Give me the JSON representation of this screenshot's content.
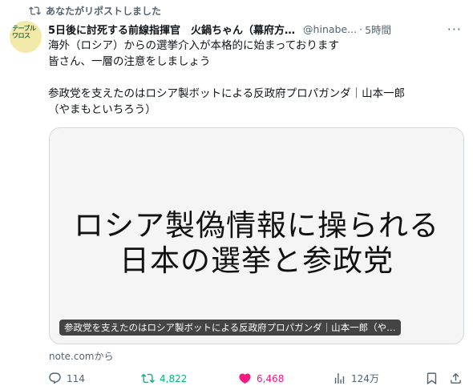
{
  "repost": {
    "label": "あなたがリポストしました"
  },
  "author": {
    "avatar_label": "テーブルワロス",
    "display_name": "5日後に討死する前線指揮官　火鍋ちゃん（幕府方…",
    "handle": "@hinabe...",
    "time": "5時間"
  },
  "tweet": {
    "line1": "海外（ロシア）からの選挙介入が本格的に始まっております",
    "line2": "皆さん、一層の注意をしましょう",
    "line3": "参政党を支えたのはロシア製ボットによる反政府プロパガンダ｜山本一郎",
    "line4": "（やまもといちろう）"
  },
  "card": {
    "headline_1": "ロシア製偽情報に操られる",
    "headline_2": "日本の選挙と参政党",
    "caption": "参政党を支えたのはロシア製ボットによる反政府プロパガンダ｜山本一郎（や…",
    "source": "note.comから"
  },
  "actions": {
    "replies": "114",
    "reposts": "4,822",
    "likes": "6,468",
    "views": "124万"
  },
  "colors": {
    "repost_green": "#00ba7c",
    "like_pink": "#f91880",
    "muted": "#536471"
  }
}
